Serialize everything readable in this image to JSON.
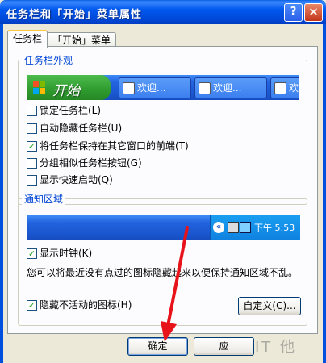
{
  "window": {
    "title": "任务栏和「开始」菜单属性",
    "help_glyph": "?",
    "close_glyph": "✕"
  },
  "tabs": [
    {
      "label": "任务栏"
    },
    {
      "label": "「开始」菜单"
    }
  ],
  "taskbar_group": {
    "title": "任务栏外观",
    "preview": {
      "start_label": "开始",
      "buttons": [
        {
          "label": "欢迎..."
        },
        {
          "label": "欢迎..."
        },
        {
          "label": "欢迎"
        }
      ]
    },
    "options": [
      {
        "label": "锁定任务栏(L)",
        "checked": false
      },
      {
        "label": "自动隐藏任务栏(U)",
        "checked": false
      },
      {
        "label": "将任务栏保持在其它窗口的前端(T)",
        "checked": true
      },
      {
        "label": "分组相似任务栏按钮(G)",
        "checked": false
      },
      {
        "label": "显示快速启动(Q)",
        "checked": false
      }
    ]
  },
  "notify_group": {
    "title": "通知区域",
    "clock": "下午 5:53",
    "chevron_glyph": "«",
    "show_clock": {
      "label": "显示时钟(K)",
      "checked": true
    },
    "info": "您可以将最近没有点过的图标隐藏起来以便保持通知区域不乱。",
    "hide_inactive": {
      "label": "隐藏不活动的图标(H)",
      "checked": true
    },
    "customize_label": "自定义(C)..."
  },
  "buttons": {
    "ok": "确定",
    "cancel": "应"
  },
  "watermark": "IT 他",
  "colors": {
    "titlebar": "#0058ee",
    "accent_blue": "#0046d5",
    "arrow_red": "#e8131a",
    "check_green": "#21a121"
  }
}
